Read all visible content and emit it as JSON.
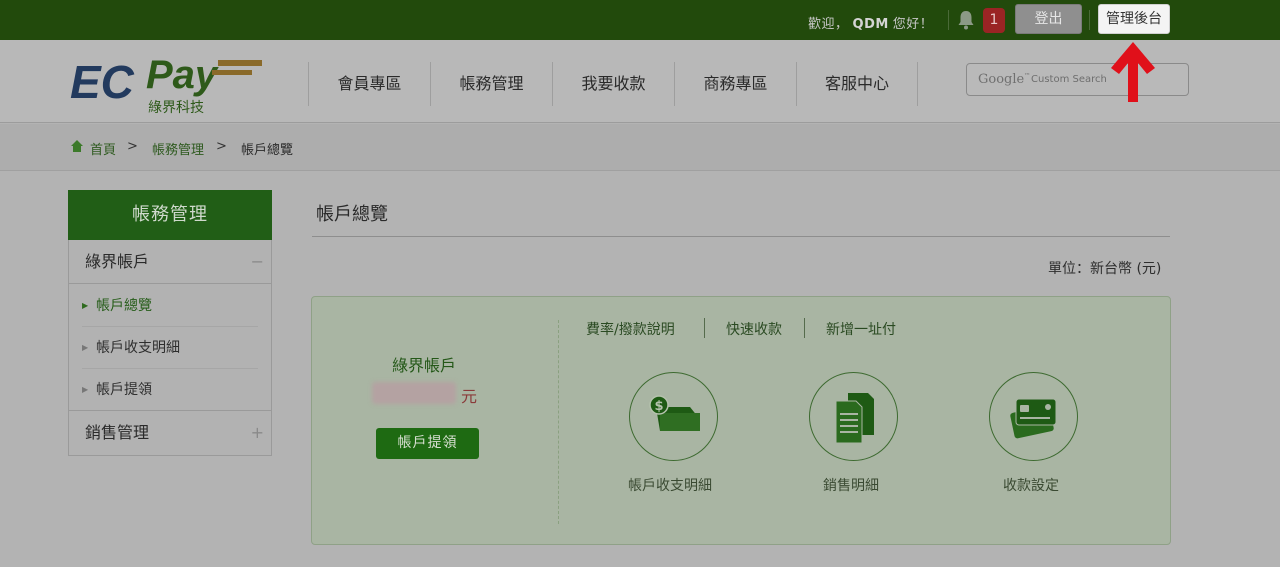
{
  "topbar": {
    "welcome_prefix": "歡迎，",
    "user": "QDM",
    "welcome_suffix": "您好！",
    "notification_count": "1",
    "logout_label": "登出",
    "admin_label": "管理後台"
  },
  "header": {
    "logo_text": "ECPay",
    "logo_subtext": "綠界科技",
    "nav": [
      "會員專區",
      "帳務管理",
      "我要收款",
      "商務專區",
      "客服中心"
    ],
    "search_brand": "Google",
    "search_placeholder": "Custom Search"
  },
  "breadcrumb": {
    "home": "首頁",
    "sep": ">",
    "level1": "帳務管理",
    "level2": "帳戶總覽"
  },
  "sidebar": {
    "title": "帳務管理",
    "group1": {
      "label": "綠界帳戶",
      "toggle": "−"
    },
    "items": [
      "帳戶總覽",
      "帳戶收支明細",
      "帳戶提領"
    ],
    "group2": {
      "label": "銷售管理",
      "toggle": "+"
    }
  },
  "main": {
    "title": "帳戶總覽",
    "unit": "單位：新台幣 (元)",
    "account": {
      "label": "綠界帳戶",
      "currency": "元",
      "withdraw_label": "帳戶提領"
    },
    "links": [
      "費率/撥款說明",
      "快速收款",
      "新增一址付"
    ],
    "shortcuts": [
      "帳戶收支明細",
      "銷售明細",
      "收款設定"
    ]
  },
  "colors": {
    "topbar": "#224a0c",
    "accent": "#215e16",
    "highlight_arrow": "#e0101a"
  }
}
